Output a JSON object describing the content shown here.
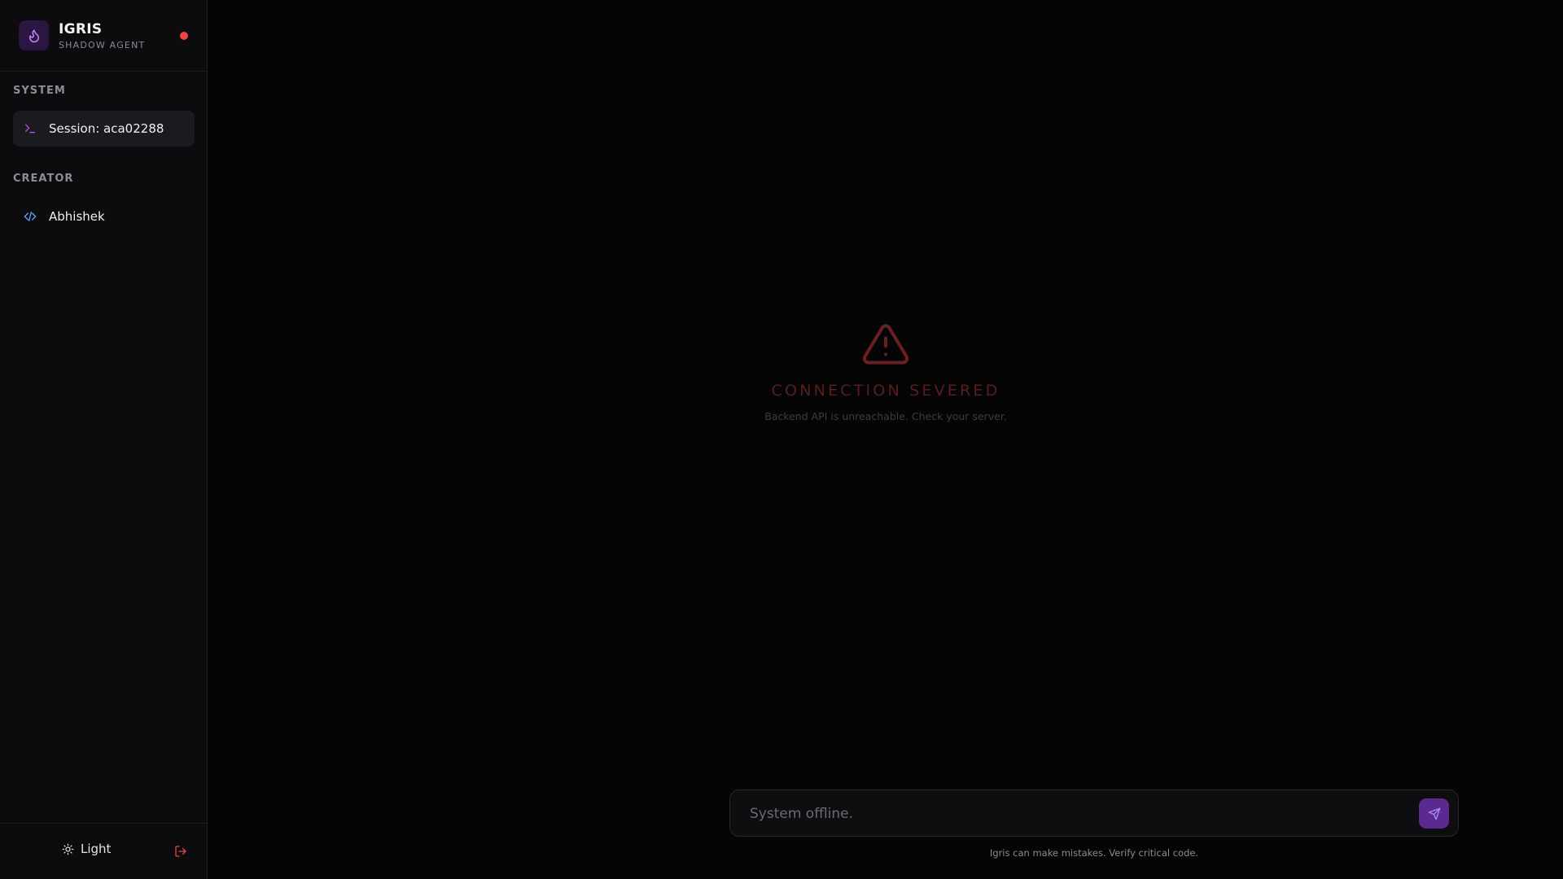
{
  "sidebar": {
    "brand": {
      "title": "IGRIS",
      "subtitle": "SHADOW AGENT",
      "logo_icon": "flame-icon",
      "status_color": "#ef4444"
    },
    "sections": [
      {
        "title": "SYSTEM",
        "items": [
          {
            "label": "Session: aca02288",
            "icon": "terminal-icon",
            "active": true
          }
        ]
      },
      {
        "title": "CREATOR",
        "items": [
          {
            "label": "Abhishek",
            "icon": "code-icon",
            "active": false
          }
        ]
      }
    ],
    "footer": {
      "theme_label": "Light",
      "theme_icon": "sun-icon",
      "logout_icon": "logout-icon"
    }
  },
  "main": {
    "error": {
      "icon": "warning-triangle-icon",
      "title": "CONNECTION SEVERED",
      "description": "Backend API is unreachable. Check your server."
    },
    "composer": {
      "placeholder": "System offline.",
      "send_icon": "send-icon"
    },
    "disclaimer": "Igris can make mistakes. Verify critical code."
  },
  "colors": {
    "accent": "#5b2a91",
    "error": "#ef4444",
    "background": "#050506",
    "sidebar": "#0c0c0f"
  }
}
